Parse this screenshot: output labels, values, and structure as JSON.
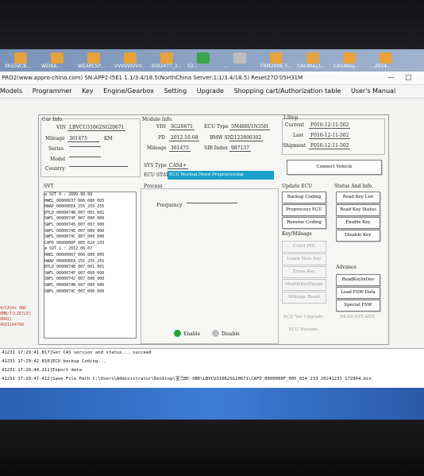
{
  "desktop": {
    "icons": [
      {
        "label": "PASSVCB...",
        "color": "#e6a23c"
      },
      {
        "label": "WEIKA...",
        "color": "#e6a23c"
      },
      {
        "label": "WEARCSP...",
        "color": "#e6a23c"
      },
      {
        "label": "VVVVWVVV...",
        "color": "#e6a23c"
      },
      {
        "label": "3002477_3...",
        "color": "#e6a23c"
      },
      {
        "label": "S3...",
        "color": "#3aa54a"
      },
      {
        "label": "...",
        "color": "#bdbdbd"
      },
      {
        "label": "FRM2006_F...",
        "color": "#e6a23c"
      },
      {
        "label": "CAS4Key1...",
        "color": "#e6a23c"
      },
      {
        "label": "CAS4Key...",
        "color": "#e6a23c"
      },
      {
        "label": "...2024...",
        "color": "#e6a23c"
      }
    ]
  },
  "window": {
    "title": "PRO2(www.appro-china.com)  SN:APP2-I5E1  1.1/3.4/18.5(NorthChina Server:1;1/3.4/18.5)  Reset27D'05H31M",
    "minimize": "—",
    "maximize": "□"
  },
  "menu": [
    "Models",
    "Programmer",
    "Key",
    "Engine/Gearbox",
    "Setting",
    "Upgrade",
    "Shopping cart/Authorization table",
    "User's Manual"
  ],
  "car_info": {
    "heading": "Car Info.",
    "vin_label": "VIN",
    "vin": "LBVCU31062SG20671",
    "mileage_label": "Mileage",
    "mileage": "361475",
    "mileage_unit": "KM",
    "series_label": "Series",
    "model_label": "Model",
    "country_label": "Country"
  },
  "module_info": {
    "heading": "Module Info.",
    "vin_label": "VIN",
    "vin": "SG20671",
    "pd_label": "PD",
    "pd": "2012.10.08",
    "mileage_label": "Mileage",
    "mileage": "361475",
    "ecu_type_label": "ECU Type",
    "ecu_type": "5M48H/1N35H",
    "bmw_sn_label": "BMW SN",
    "bmw_sn": "2122800302",
    "sib_index_label": "SIB Index",
    "sib_index": "987137",
    "sys_type_label": "SYS Type",
    "sys_type": "CAS4+",
    "ecu_stat_label": "ECU STAT",
    "ecu_stat": "ECU Normal,Need Preprocessing"
  },
  "i_step": {
    "heading": "I-Step",
    "current_label": "Current",
    "current": "F010-12-11-502",
    "last_label": "Last",
    "last": "F010-12-11-502",
    "shipment_label": "Shipment",
    "shipment": "F010-12-11-502"
  },
  "buttons": {
    "connect_vehicle": "Connect Vehicle",
    "backup_coding": "Backup Coding",
    "preprocess_ecu": "Preprocess ECU",
    "resume_coding": "Resume Coding",
    "read_key_list": "Read Key List",
    "read_key_status": "Read Key Status",
    "enable_key": "Enable Key",
    "disable_key": "Disable Key",
    "cas4_pin": "CAS4 PIN",
    "learn_new_key": "Learn New Key",
    "erase_key": "Erase Key",
    "modify_key_param": "ModifyKeyParam",
    "mileage_reset": "Mileage Reset",
    "ecu_ver_upgrade": "ECU Ver Upgrade",
    "ecu_resume": "ECU Resume",
    "read_key_in_dev": "ReadKeyInDev",
    "load_fsw_data": "Load FSW Data",
    "special_fsw": "Special FSW",
    "read_8_flash": "READ 8/FLASH"
  },
  "sections": {
    "svt": "SVT",
    "process": "Process",
    "frequency_label": "Frequency",
    "update_ecu": "Update ECU",
    "status_info": "Status And Info.",
    "key_mileage": "Key/Mileage",
    "advance": "Advance"
  },
  "svt_tree": [
    "⊟ SVT 0 : 2099.99.99",
    "    HWEL_00000037_006_000_005",
    "    HWAP_00000EEA_255_255_255",
    "    BTLD_0000074B_007_001_001",
    "    SWFL_0000074F_007_000_000",
    "    SWFL_00000745_007_007_000",
    "    SWFL_0000074E_007_000_000",
    "    SWFL_0000074C_007_000_000",
    "    CAFD_0000000F_005_024_233",
    "⊟ SVT 1 : 2012.06.07",
    "    HWEL_00000007_006_000_005",
    "    HWAP_00000EEA_255_255_255",
    "    BTLD_0000074B_007_001_001",
    "    SWFL_0000074F_007_000_000",
    "    SWFL_00000742_007_000_000",
    "    SWFL_0000074B_007_000_000",
    "    SWFL_0000074C_007_000_000"
  ],
  "legend": {
    "enable": "Enable",
    "disable": "Disable",
    "enable_color": "#22a33a",
    "disable_color": "#bdbdbd"
  },
  "left_strip": [
    "4/CAS4+ OBD",
    "0MN/T(LIE/LE)",
    "0M42)",
    "",
    "4021164700"
  ],
  "log": [
    "41231 17:29:41.817]Get CAS version and status... succeed",
    "41231 17:29:42.810]ECU backup Coding...",
    "41231 17:29:44.111]Export data",
    "41231 17:29:47.412]Save File Path   C:\\Users\\Administrator\\Desktop\\宝马BC-OBD\\LBVCU31062SG20671\\CAFD_0000000F_005_024_233_20241231_172944.bin"
  ]
}
